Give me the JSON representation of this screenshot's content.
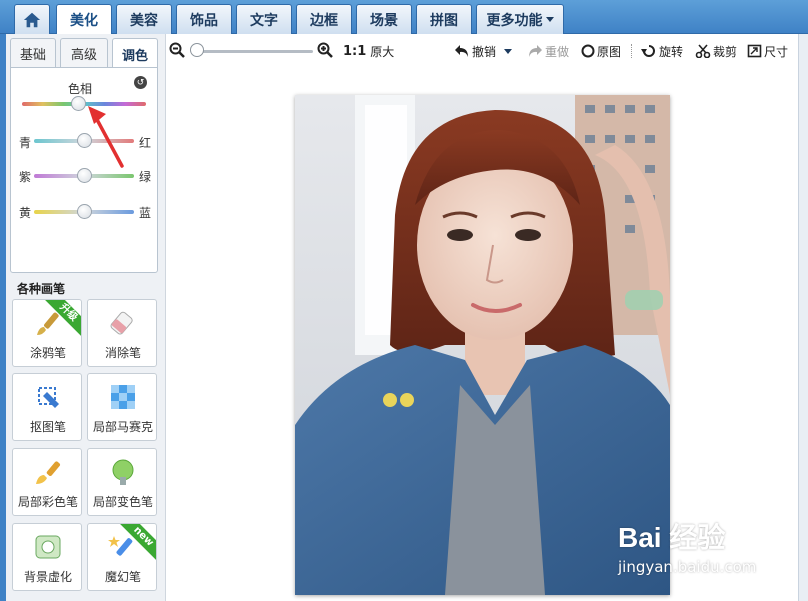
{
  "top_tabs": [
    {
      "label": "美化",
      "active": true
    },
    {
      "label": "美容",
      "active": false
    },
    {
      "label": "饰品",
      "active": false
    },
    {
      "label": "文字",
      "active": false
    },
    {
      "label": "边框",
      "active": false
    },
    {
      "label": "场景",
      "active": false
    },
    {
      "label": "拼图",
      "active": false
    },
    {
      "label": "更多功能",
      "active": false
    }
  ],
  "home_icon": "home-icon",
  "sub_tabs": [
    {
      "label": "基础",
      "active": false
    },
    {
      "label": "高级",
      "active": false
    },
    {
      "label": "调色",
      "active": true
    }
  ],
  "adjust": {
    "hue_label": "色相",
    "reset_icon": "reset-icon",
    "hue_value": 0.45,
    "sliders": [
      {
        "left": "青",
        "right": "红",
        "value": 0.5
      },
      {
        "left": "紫",
        "right": "绿",
        "value": 0.5
      },
      {
        "left": "黄",
        "right": "蓝",
        "value": 0.5
      }
    ]
  },
  "brushes": {
    "title": "各种画笔",
    "items": [
      {
        "label": "涂鸦笔",
        "icon": "brush-icon",
        "badge": "升级"
      },
      {
        "label": "消除笔",
        "icon": "eraser-icon",
        "badge": ""
      },
      {
        "label": "抠图笔",
        "icon": "cutout-pen-icon",
        "badge": ""
      },
      {
        "label": "局部马赛克",
        "icon": "mosaic-icon",
        "badge": ""
      },
      {
        "label": "局部彩色笔",
        "icon": "color-brush-icon",
        "badge": ""
      },
      {
        "label": "局部变色笔",
        "icon": "color-change-icon",
        "badge": ""
      },
      {
        "label": "背景虚化",
        "icon": "blur-icon",
        "badge": ""
      },
      {
        "label": "魔幻笔",
        "icon": "magic-pen-icon",
        "badge": "new"
      }
    ]
  },
  "toolbar": {
    "zoom_level": 0,
    "ratio_label": "1:1",
    "original_size": "原大",
    "undo": "撤销",
    "redo": "重做",
    "original": "原图",
    "rotate": "旋转",
    "crop": "裁剪",
    "size": "尺寸"
  },
  "watermark": {
    "logo": "Bai 经验",
    "url": "jingyan.baidu.com"
  },
  "colors": {
    "tab_bar": "#3f82c6",
    "annotation_arrow": "#e23030",
    "badge_green": "#3aa832"
  }
}
